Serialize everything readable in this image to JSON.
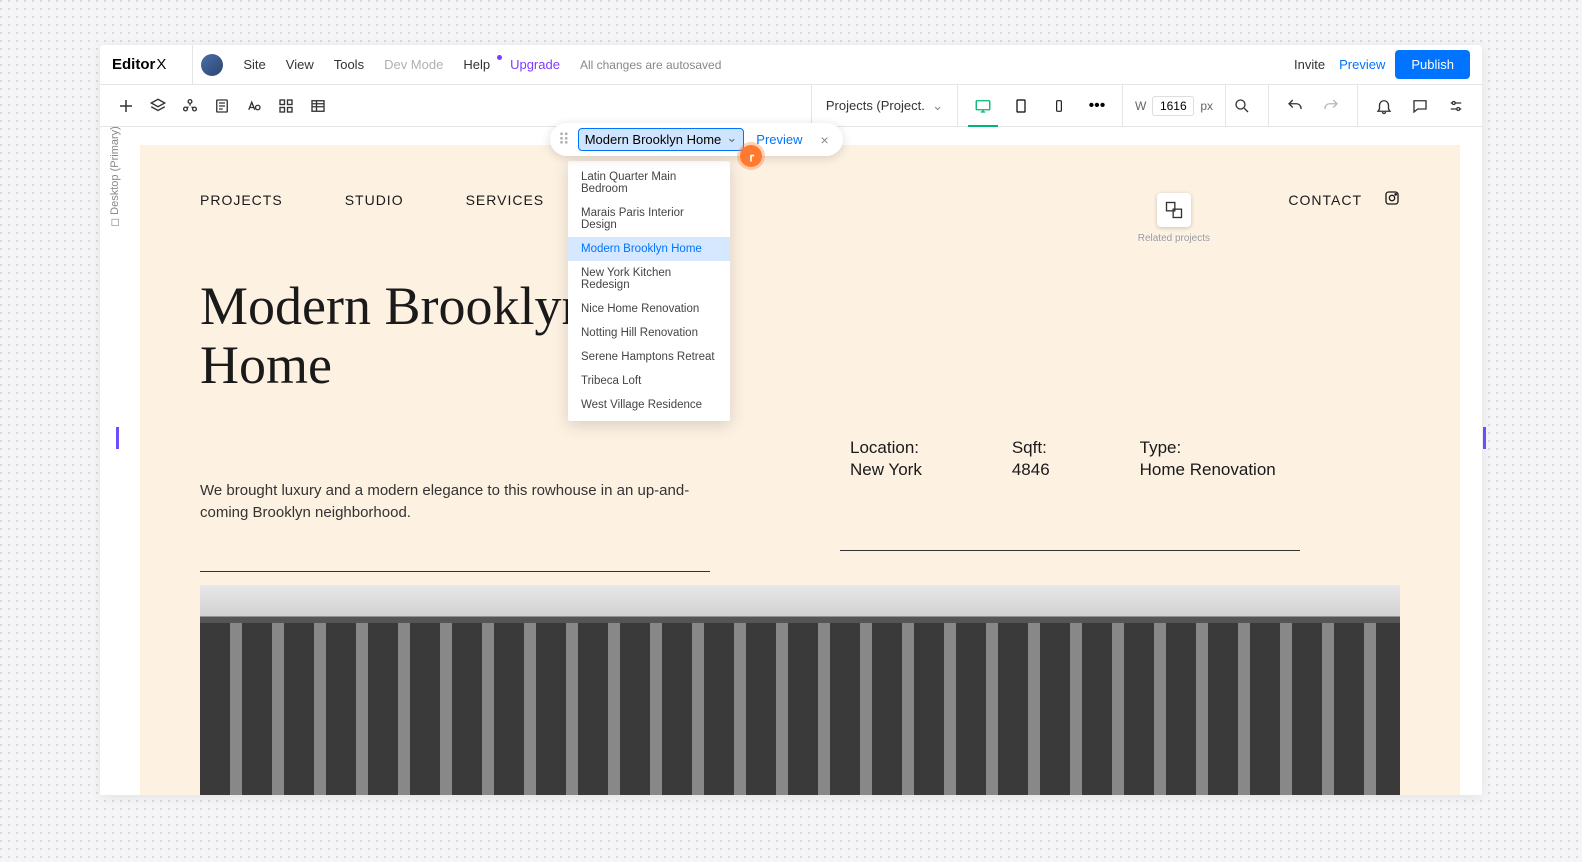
{
  "app": {
    "logo": "Editor",
    "logoSuffix": "X"
  },
  "topMenu": {
    "items": [
      "Site",
      "View",
      "Tools"
    ],
    "devMode": "Dev Mode",
    "help": "Help",
    "upgrade": "Upgrade",
    "autosave": "All changes are autosaved",
    "invite": "Invite",
    "preview": "Preview",
    "publish": "Publish"
  },
  "toolbar": {
    "breadcrumb": "Projects (Project.",
    "widthLabel": "W",
    "widthValue": "1616",
    "widthUnit": "px"
  },
  "sideLabel": "Desktop (Primary)",
  "pill": {
    "selected": "Modern Brooklyn Home",
    "preview": "Preview",
    "close": "×"
  },
  "dropdownOptions": [
    "Latin Quarter Main Bedroom",
    "Marais Paris Interior Design",
    "Modern Brooklyn Home",
    "New York Kitchen Redesign",
    "Nice Home Renovation",
    "Notting Hill Renovation",
    "Serene Hamptons Retreat",
    "Tribeca Loft",
    "West Village Residence"
  ],
  "widgetLabel": "Related projects",
  "siteNav": {
    "items": [
      "PROJECTS",
      "STUDIO",
      "SERVICES"
    ],
    "contact": "CONTACT"
  },
  "page": {
    "title": "Modern Brooklyn Home",
    "desc": "We brought luxury and a modern elegance to this rowhouse in an up-and-coming Brooklyn neighborhood.",
    "meta": {
      "locationLabel": "Location:",
      "locationValue": "New York",
      "sqftLabel": "Sqft:",
      "sqftValue": "4846",
      "typeLabel": "Type:",
      "typeValue": "Home Renovation"
    }
  }
}
